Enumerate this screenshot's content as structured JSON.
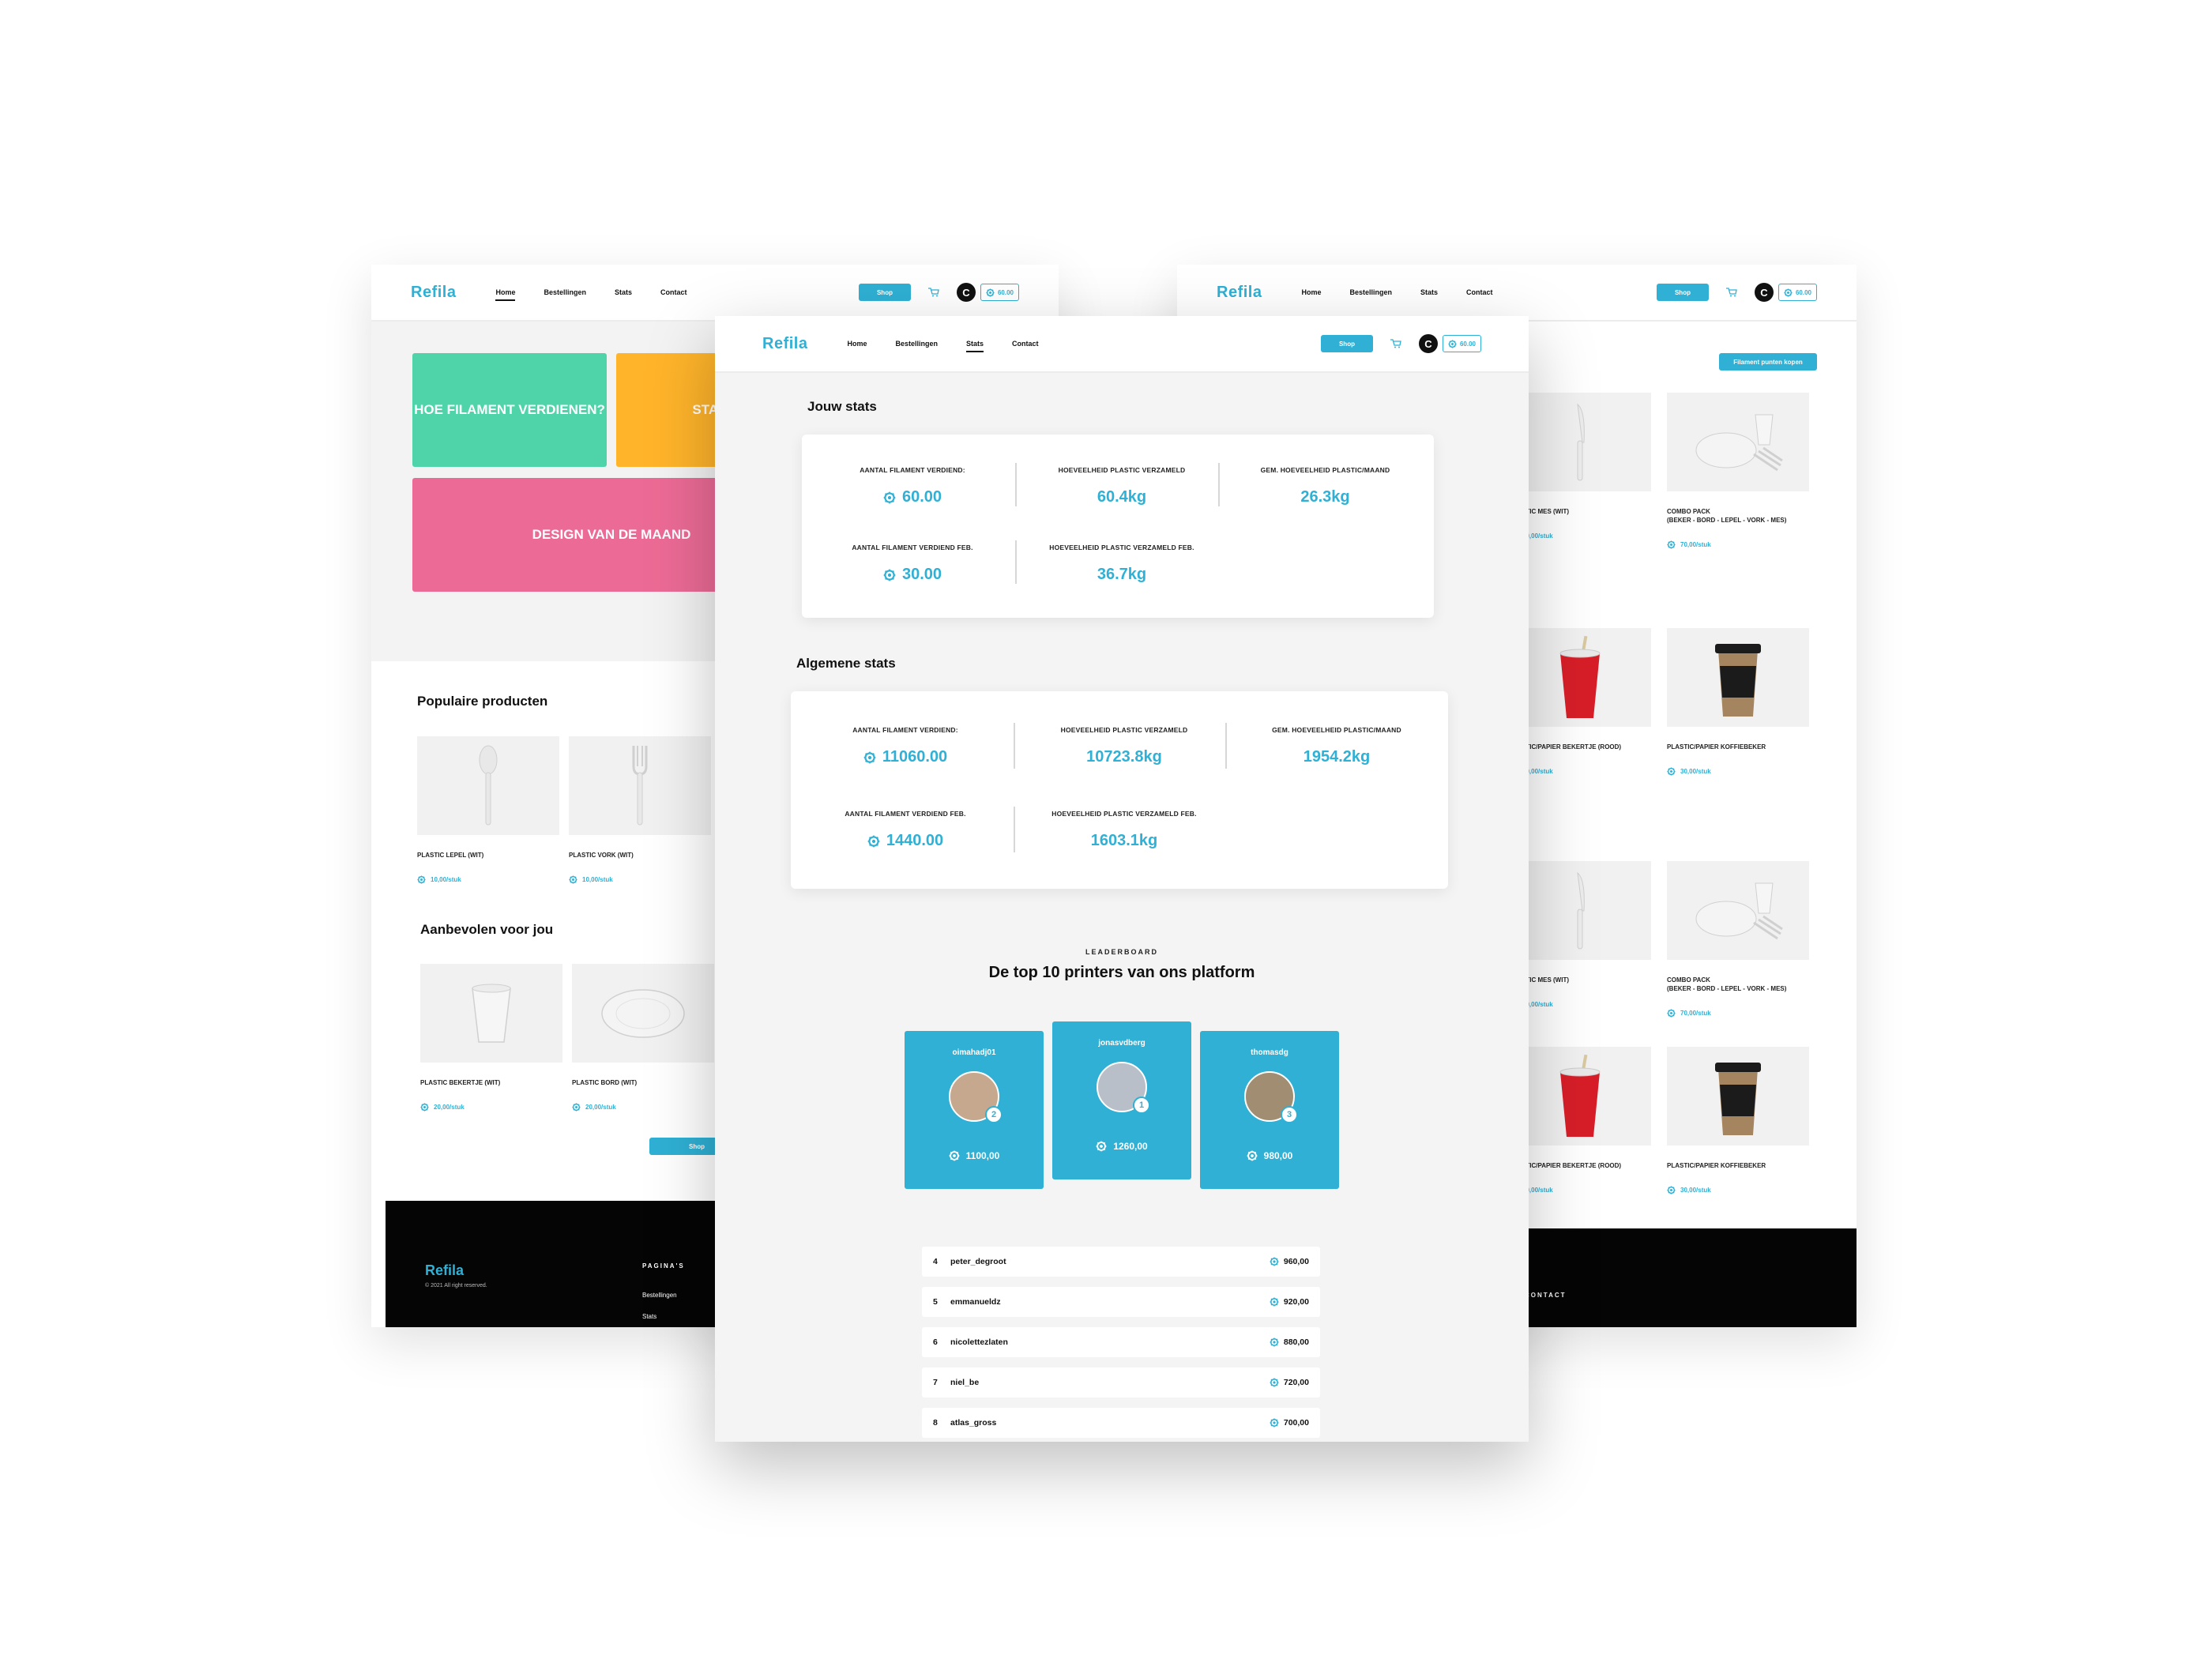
{
  "colors": {
    "accent": "#2fb0d4",
    "tile_green": "#4fd4aa",
    "tile_yellow": "#ffb42a",
    "tile_pink": "#ec6b96",
    "footer": "#050505"
  },
  "icons": {
    "filament": "filament-coin-icon",
    "cart": "cart-icon",
    "avatar": "user-avatar-icon"
  },
  "nav": {
    "logo": "Refila",
    "home": "Home",
    "orders": "Bestellingen",
    "stats": "Stats",
    "contact": "Contact",
    "shop": "Shop",
    "balance": "60.00",
    "avatar_letter": "C"
  },
  "left_page": {
    "tiles": {
      "earn": "HOE FILAMENT VERDIENEN?",
      "stats": "STATS",
      "design": "DESIGN VAN DE MAAND"
    },
    "popular_title": "Populaire producten",
    "popular": [
      {
        "name": "PLASTIC LEPEL (WIT)",
        "price": "10,00/stuk"
      },
      {
        "name": "PLASTIC VORK (WIT)",
        "price": "10,00/stuk"
      }
    ],
    "recommended_title": "Aanbevolen voor jou",
    "recommended": [
      {
        "name": "PLASTIC BEKERTJE (WIT)",
        "price": "20,00/stuk"
      },
      {
        "name": "PLASTIC BORD (WIT)",
        "price": "20,00/stuk"
      }
    ],
    "shop_button": "Shop",
    "footer": {
      "logo": "Refila",
      "copyright": "© 2021 All right reserved.",
      "pages_heading": "PAGINA'S",
      "link_orders": "Bestellingen",
      "link_stats": "Stats"
    }
  },
  "right_page": {
    "buy_button": "Filament punten kopen",
    "products": [
      {
        "name": "PLASTIC MES (WIT)",
        "price": "10,00/stuk"
      },
      {
        "name": "COMBO PACK\n(BEKER - BORD - LEPEL - VORK - MES)",
        "price": "70,00/stuk"
      },
      {
        "name": "PLASTIC/PAPIER BEKERTJE (ROOD)",
        "price": "30,00/stuk"
      },
      {
        "name": "PLASTIC/PAPIER KOFFIEBEKER",
        "price": "30,00/stuk"
      },
      {
        "name": "PLASTIC MES (WIT)",
        "price": "10,00/stuk"
      },
      {
        "name": "COMBO PACK\n(BEKER - BORD - LEPEL - VORK - MES)",
        "price": "70,00/stuk"
      },
      {
        "name": "PLASTIC/PAPIER BEKERTJE (ROOD)",
        "price": "30,00/stuk"
      },
      {
        "name": "PLASTIC/PAPIER KOFFIEBEKER",
        "price": "30,00/stuk"
      }
    ],
    "footer_contact": "CONTACT"
  },
  "stats_page": {
    "your_stats_title": "Jouw stats",
    "your_stats": {
      "earned_label": "AANTAL FILAMENT VERDIEND:",
      "earned": "60.00",
      "collected_label": "HOEVEELHEID PLASTIC VERZAMELD",
      "collected": "60.4kg",
      "avg_label": "GEM. HOEVEELHEID PLASTIC/MAAND",
      "avg": "26.3kg",
      "earned_feb_label": "AANTAL FILAMENT VERDIEND FEB.",
      "earned_feb": "30.00",
      "collected_feb_label": "HOEVEELHEID PLASTIC VERZAMELD FEB.",
      "collected_feb": "36.7kg"
    },
    "general_stats_title": "Algemene stats",
    "general_stats": {
      "earned_label": "AANTAL FILAMENT VERDIEND:",
      "earned": "11060.00",
      "collected_label": "HOEVEELHEID PLASTIC VERZAMELD",
      "collected": "10723.8kg",
      "avg_label": "GEM. HOEVEELHEID PLASTIC/MAAND",
      "avg": "1954.2kg",
      "earned_feb_label": "AANTAL FILAMENT VERDIEND FEB.",
      "earned_feb": "1440.00",
      "collected_feb_label": "HOEVEELHEID PLASTIC VERZAMELD FEB.",
      "collected_feb": "1603.1kg"
    },
    "leaderboard_kicker": "LEADERBOARD",
    "leaderboard_title": "De top 10 printers van ons platform",
    "podium": [
      {
        "user": "oimahadj01",
        "rank": "2",
        "points": "1100,00"
      },
      {
        "user": "jonasvdberg",
        "rank": "1",
        "points": "1260,00"
      },
      {
        "user": "thomasdg",
        "rank": "3",
        "points": "980,00"
      }
    ],
    "rows": [
      {
        "rank": "4",
        "user": "peter_degroot",
        "points": "960,00"
      },
      {
        "rank": "5",
        "user": "emmanueldz",
        "points": "920,00"
      },
      {
        "rank": "6",
        "user": "nicolettezlaten",
        "points": "880,00"
      },
      {
        "rank": "7",
        "user": "niel_be",
        "points": "720,00"
      },
      {
        "rank": "8",
        "user": "atlas_gross",
        "points": "700,00"
      }
    ]
  }
}
